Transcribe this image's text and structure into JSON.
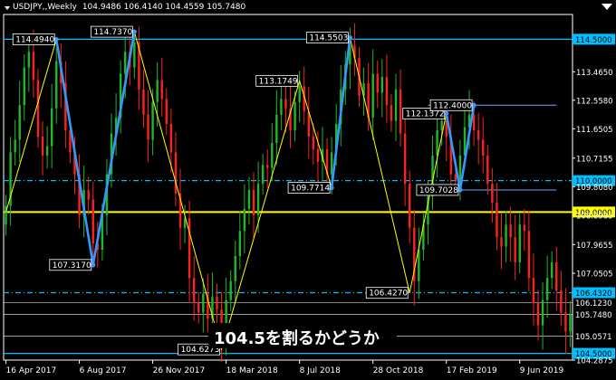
{
  "header": {
    "symbol": "USDJPY,,Weekly",
    "ohlc": "104.9486 106.4140 104.4559 105.7480"
  },
  "caption": "104.5を割るかどうか",
  "colors": {
    "background": "#000000",
    "bull": "#1fb82a",
    "bear": "#ff2020",
    "zigzag_thin": "#ffff00",
    "zigzag_thick": "#3399ff",
    "level_line": "#00bfff",
    "key_line": "#ffff00",
    "dotted_line": "#00bfff",
    "grid": "#ffffff"
  },
  "chart_data": {
    "type": "candlestick",
    "ylim": [
      104.2875,
      115.2875
    ],
    "y_ticks": [
      "114.5000",
      "113.4650",
      "112.5580",
      "111.6505",
      "110.7155",
      "110.0000",
      "109.8080",
      "109.0000",
      "108.8985",
      "107.9655",
      "107.0505",
      "106.4320",
      "106.1230",
      "105.7480",
      "105.0571",
      "104.5000",
      "104.2875"
    ],
    "x_ticks": [
      "16 Apr 2017",
      "6 Aug 2017",
      "26 Nov 2017",
      "18 Mar 2018",
      "8 Jul 2018",
      "28 Oct 2018",
      "17 Feb 2019",
      "9 Jun 2019"
    ],
    "x_tick_index": [
      0,
      16,
      32,
      48,
      64,
      80,
      96,
      112
    ],
    "bar_count": 124,
    "horizontal_lines": [
      {
        "label": "114.5000",
        "value": 114.5,
        "style": "solid",
        "kind": "level"
      },
      {
        "label": "110.0000",
        "value": 110.0,
        "style": "dashdot",
        "kind": "dotted"
      },
      {
        "label": "109.0000",
        "value": 109.0,
        "style": "solid",
        "kind": "key"
      },
      {
        "label": "106.4320",
        "value": 106.432,
        "style": "dashdot",
        "kind": "dotted"
      },
      {
        "label": "104.5000",
        "value": 104.5,
        "style": "solid",
        "kind": "level"
      }
    ],
    "price_labels": [
      {
        "label": "105.7480",
        "value": 105.748
      },
      {
        "label": "105.0571",
        "value": 105.0571
      },
      {
        "label": "106.1230",
        "value": 106.123
      }
    ],
    "short_lines": [
      {
        "value": 112.4,
        "from_index": 92,
        "to_index": 120
      },
      {
        "value": 109.7028,
        "from_index": 92,
        "to_index": 120
      }
    ],
    "thin_zigzag": [
      {
        "index": 0,
        "value": 109.0
      },
      {
        "index": 11,
        "value": 114.494
      },
      {
        "index": 19,
        "value": 107.317
      },
      {
        "index": 28,
        "value": 114.737
      },
      {
        "index": 47,
        "value": 104.6273
      },
      {
        "index": 64,
        "value": 113.1749
      },
      {
        "index": 71,
        "value": 109.7714
      },
      {
        "index": 75,
        "value": 114.5503
      },
      {
        "index": 88,
        "value": 106.427
      },
      {
        "index": 96,
        "value": 112.1372
      },
      {
        "index": 99,
        "value": 109.7028
      },
      {
        "index": 102,
        "value": 112.4
      }
    ],
    "thick_zigzag": [
      {
        "index": 11,
        "value": 114.494
      },
      {
        "index": 19,
        "value": 107.317
      },
      {
        "index": 28,
        "value": 114.737
      },
      {
        "index": 71,
        "value": 109.7714
      },
      {
        "index": 75,
        "value": 114.5503
      },
      {
        "index": 96,
        "value": 112.1372
      },
      {
        "index": 99,
        "value": 109.7028
      },
      {
        "index": 102,
        "value": 112.4
      }
    ],
    "pivot_labels": [
      {
        "text": "114.4940",
        "index": 11,
        "value": 114.494
      },
      {
        "text": "114.7370",
        "index": 28,
        "value": 114.737
      },
      {
        "text": "107.3170",
        "index": 19,
        "value": 107.317
      },
      {
        "text": "104.6273",
        "index": 47,
        "value": 104.6273
      },
      {
        "text": "113.1749",
        "index": 64,
        "value": 113.1749
      },
      {
        "text": "109.7714",
        "index": 71,
        "value": 109.7714
      },
      {
        "text": "114.5503",
        "index": 75,
        "value": 114.5503
      },
      {
        "text": "106.4270",
        "index": 88,
        "value": 106.427
      },
      {
        "text": "112.1372",
        "index": 96,
        "value": 112.1372
      },
      {
        "text": "112.4000",
        "index": 102,
        "value": 112.4
      },
      {
        "text": "109.7028",
        "index": 99,
        "value": 109.7028
      }
    ],
    "closes": [
      109.2,
      110.9,
      111.3,
      112.4,
      113.6,
      114.1,
      113.2,
      111.4,
      110.8,
      111.1,
      112.3,
      113.8,
      113.1,
      111.6,
      110.9,
      110.2,
      108.9,
      109.7,
      109.4,
      108.0,
      107.8,
      108.9,
      110.2,
      111.5,
      112.0,
      113.4,
      114.1,
      113.6,
      114.4,
      112.9,
      112.1,
      111.3,
      112.5,
      113.2,
      112.6,
      111.8,
      110.9,
      109.6,
      108.5,
      108.8,
      106.9,
      106.1,
      105.8,
      106.4,
      105.6,
      106.3,
      105.9,
      105.0,
      106.2,
      106.8,
      107.6,
      108.4,
      109.1,
      109.7,
      108.9,
      109.9,
      110.5,
      110.4,
      111.2,
      112.1,
      112.6,
      112.3,
      111.6,
      112.5,
      113.0,
      112.2,
      111.4,
      111.0,
      110.6,
      111.0,
      110.2,
      110.9,
      111.8,
      112.9,
      113.7,
      114.3,
      113.9,
      112.7,
      113.1,
      112.0,
      113.4,
      112.8,
      113.3,
      112.4,
      111.9,
      112.9,
      111.5,
      109.9,
      108.5,
      106.8,
      107.8,
      108.6,
      109.5,
      110.8,
      111.6,
      111.9,
      111.4,
      110.2,
      110.0,
      110.8,
      111.7,
      112.1,
      111.6,
      111.3,
      110.8,
      109.9,
      109.3,
      108.2,
      107.9,
      108.6,
      108.2,
      107.4,
      108.6,
      108.4,
      106.9,
      106.1,
      105.4,
      106.2,
      106.9,
      107.4,
      106.5,
      105.8,
      105.2,
      105.748
    ]
  }
}
